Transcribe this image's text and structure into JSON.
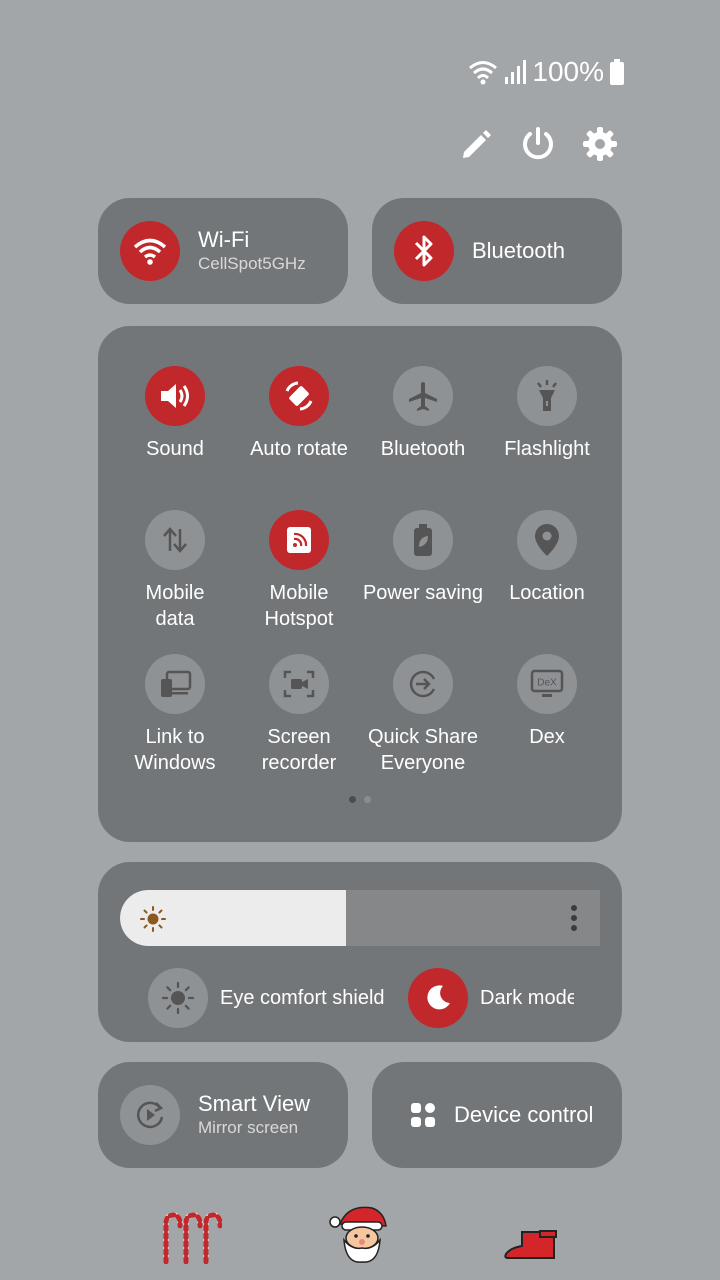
{
  "status_bar": {
    "battery_text": "100%"
  },
  "colors": {
    "accent_on": "#c0282c",
    "tile_off": "#8f9295",
    "panel": "#737678",
    "background": "#a3a6a8"
  },
  "big_tiles": [
    {
      "title": "Wi-Fi",
      "subtitle": "CellSpot5GHz",
      "icon": "wifi-icon",
      "on": true
    },
    {
      "title": "Bluetooth",
      "subtitle": "",
      "icon": "bluetooth-icon",
      "on": true
    }
  ],
  "quick_settings": [
    {
      "label": "Sound",
      "icon": "volume-icon",
      "on": true
    },
    {
      "label": "Auto rotate",
      "icon": "auto-rotate-icon",
      "on": true
    },
    {
      "label": "Bluetooth",
      "icon": "airplane-icon",
      "on": false
    },
    {
      "label": "Flashlight",
      "icon": "flashlight-icon",
      "on": false
    },
    {
      "label": "Mobile\ndata",
      "icon": "mobile-data-icon",
      "on": false
    },
    {
      "label": "Mobile\nHotspot",
      "icon": "hotspot-icon",
      "on": true
    },
    {
      "label": "Power saving",
      "icon": "power-saving-icon",
      "on": false
    },
    {
      "label": "Location",
      "icon": "location-icon",
      "on": false
    },
    {
      "label": "Link to\nWindows",
      "icon": "link-to-windows-icon",
      "on": false
    },
    {
      "label": "Screen\nrecorder",
      "icon": "screen-recorder-icon",
      "on": false
    },
    {
      "label": "Quick Share\nEveryone",
      "icon": "quick-share-icon",
      "on": false
    },
    {
      "label": "Dex",
      "icon": "dex-icon",
      "on": false
    }
  ],
  "pager": {
    "pages": 2,
    "current": 1
  },
  "brightness": {
    "level": 0.47
  },
  "display_toggles": {
    "eye_comfort": {
      "label": "Eye comfort shield",
      "on": false
    },
    "dark_mode": {
      "label": "Dark mode",
      "on": true
    }
  },
  "bottom_tiles": [
    {
      "title": "Smart View",
      "subtitle": "Mirror screen",
      "icon": "smart-view-icon"
    },
    {
      "title": "Device control",
      "subtitle": "",
      "icon": "device-control-icon"
    }
  ]
}
